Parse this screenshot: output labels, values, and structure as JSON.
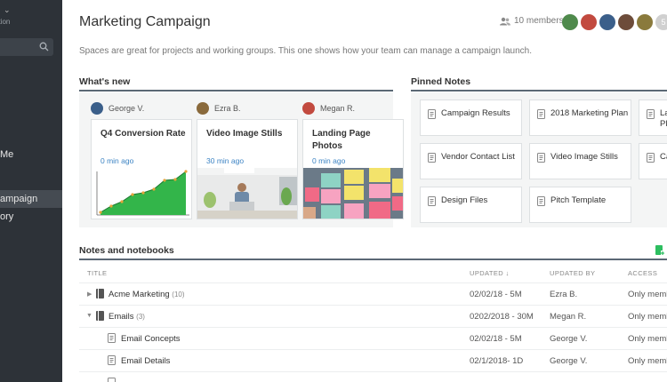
{
  "sidebar": {
    "top_sub": "ation",
    "items": [
      {
        "label": "Me",
        "active": false
      },
      {
        "label": "ampaign",
        "active": true
      },
      {
        "label": "ory",
        "active": false
      }
    ]
  },
  "header": {
    "title": "Marketing Campaign",
    "members": "10 members",
    "more_members": "5",
    "description": "Spaces are great for projects and working groups. This one shows how your team can manage a campaign launch."
  },
  "whats_new": {
    "heading": "What's new",
    "cards": [
      {
        "author": "George V.",
        "title": "Q4 Conversion Rate",
        "time": "0 min ago"
      },
      {
        "author": "Ezra B.",
        "title": "Video Image Stills",
        "time": "30 min ago"
      },
      {
        "author": "Megan R.",
        "title": "Landing Page Photos",
        "time": "0 min ago"
      }
    ]
  },
  "pinned": {
    "heading": "Pinned Notes",
    "notes": [
      "Campaign Results",
      "2018 Marketing Plan",
      "La Pl",
      "Vendor Contact List",
      "Video Image Stills",
      "Ca",
      "Design Files",
      "Pitch Template"
    ]
  },
  "notebooks": {
    "heading": "Notes and notebooks",
    "columns": {
      "title": "TITLE",
      "updated": "UPDATED ↓",
      "updated_by": "UPDATED BY",
      "access": "ACCESS"
    },
    "rows": [
      {
        "title": "Acme Marketing",
        "count": "(10)",
        "updated": "02/02/18 - 5M",
        "by": "Ezra B.",
        "access": "Only meml"
      },
      {
        "title": "Emails",
        "count": "(3)",
        "updated": "0202/2018 - 30M",
        "by": "Megan R.",
        "access": "Only meml"
      },
      {
        "title": "Email Concepts",
        "count": "",
        "updated": "02/02/18 - 5M",
        "by": "George V.",
        "access": "Only meml"
      },
      {
        "title": "Email Details",
        "count": "",
        "updated": "02/1/2018- 1D",
        "by": "George V.",
        "access": "Only meml"
      }
    ]
  }
}
